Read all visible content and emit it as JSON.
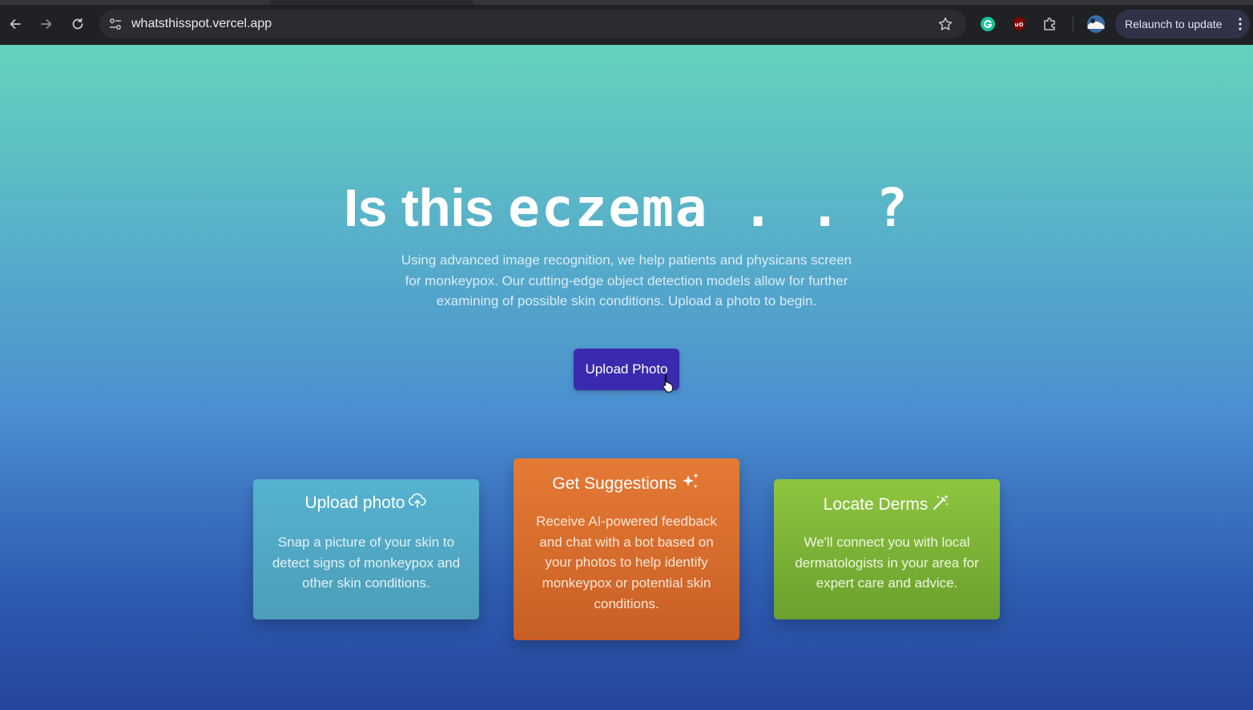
{
  "browser": {
    "url": "whatsthisspot.vercel.app",
    "relaunch_label": "Relaunch to update",
    "nav_icons": [
      "back-arrow-icon",
      "forward-arrow-icon",
      "reload-icon"
    ],
    "extension_icons": [
      "grammarly-icon",
      "ublock-origin-icon",
      "extensions-puzzle-icon",
      "profile-avatar-icon"
    ]
  },
  "hero": {
    "title_prefix": "Is this",
    "title_word": "eczema . . ?",
    "subtitle": "Using advanced image recognition, we help patients and physicans screen for monkeypox. Our cutting-edge object detection models allow for further examining of possible skin conditions. Upload a photo to begin.",
    "cta_label": "Upload Photo"
  },
  "features": [
    {
      "title": "Upload photo",
      "icon": "cloud-upload-icon",
      "description": "Snap a picture of your skin to detect signs of monkeypox and other skin conditions.",
      "color": "#56b3d0"
    },
    {
      "title": "Get Suggestions",
      "icon": "sparkles-icon",
      "description": "Receive AI-powered feedback and chat with a bot based on your photos to help identify monkeypox or potential skin conditions.",
      "color": "#e57a35"
    },
    {
      "title": "Locate Derms",
      "icon": "magic-wand-icon",
      "description": "We'll connect you with local dermatologists in your area for expert care and advice.",
      "color": "#8ec53f"
    }
  ],
  "colors": {
    "accent_button": "#3a2aae",
    "gradient_top": "#64d3bb",
    "gradient_bottom": "#24469c"
  }
}
